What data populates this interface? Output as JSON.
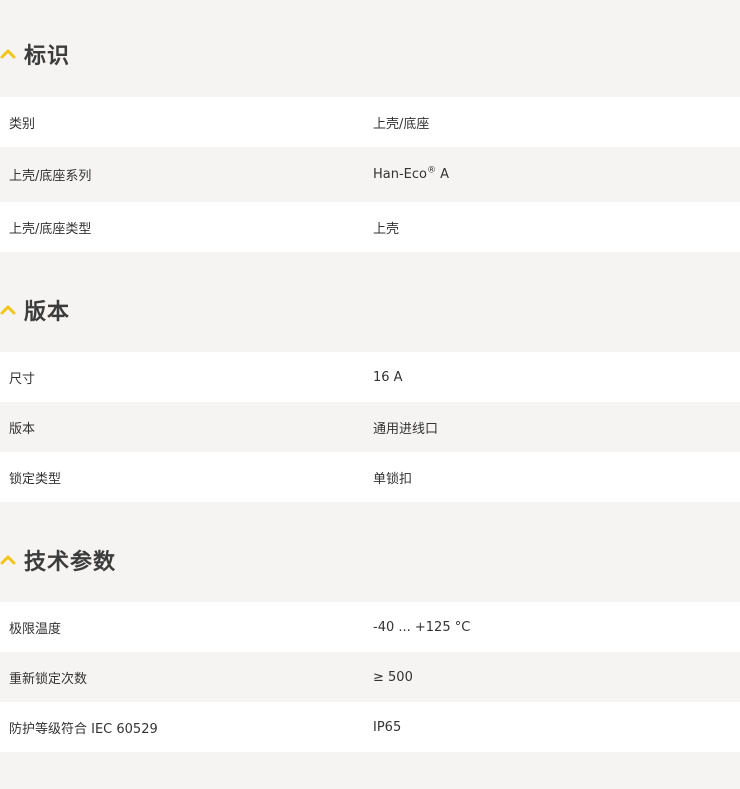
{
  "sections": [
    {
      "title": "标识",
      "rows": [
        {
          "label": "类别",
          "value": "上壳/底座"
        },
        {
          "label": "上壳/底座系列",
          "value_main": "Han-Eco",
          "value_sup": "®",
          "value_tail": " A"
        },
        {
          "label": "上壳/底座类型",
          "value": "上壳"
        }
      ]
    },
    {
      "title": "版本",
      "rows": [
        {
          "label": "尺寸",
          "value": "16 A"
        },
        {
          "label": "版本",
          "value": "通用进线口"
        },
        {
          "label": "锁定类型",
          "value": "单锁扣"
        }
      ]
    },
    {
      "title": "技术参数",
      "rows": [
        {
          "label": "极限温度",
          "value": "-40 ... +125 °C"
        },
        {
          "label": "重新锁定次数",
          "value": "≥ 500"
        },
        {
          "label": "防护等级符合 IEC 60529",
          "value": "IP65"
        }
      ]
    }
  ],
  "accent_color": "#f0c419"
}
